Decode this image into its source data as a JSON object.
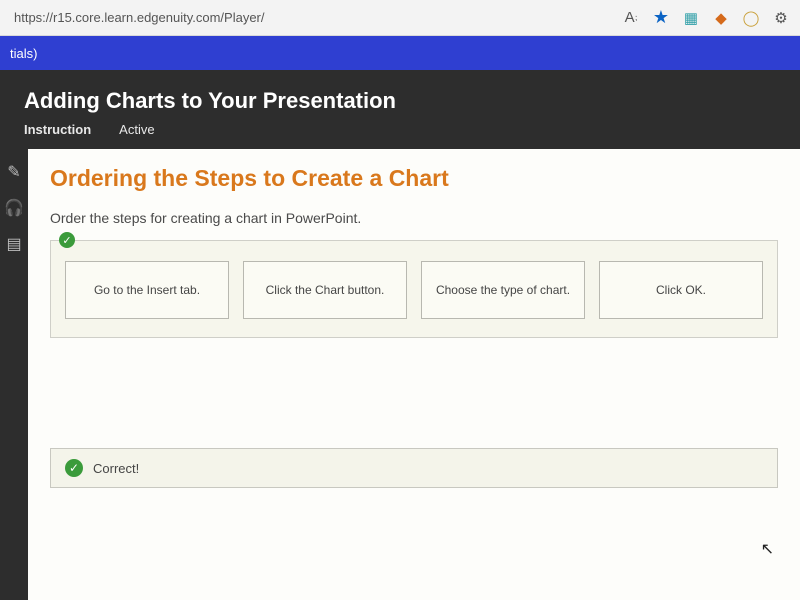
{
  "browser": {
    "url": "https://r15.core.learn.edgenuity.com/Player/"
  },
  "tabstrip": {
    "label_suffix": "tials)"
  },
  "lesson": {
    "title": "Adding Charts to Your Presentation",
    "mode_instruction": "Instruction",
    "mode_active": "Active"
  },
  "activity": {
    "heading": "Ordering the Steps to Create a Chart",
    "prompt": "Order the steps for creating a chart in PowerPoint.",
    "steps": [
      "Go to the Insert tab.",
      "Click the Chart button.",
      "Choose the type of chart.",
      "Click OK."
    ],
    "feedback": "Correct!"
  }
}
